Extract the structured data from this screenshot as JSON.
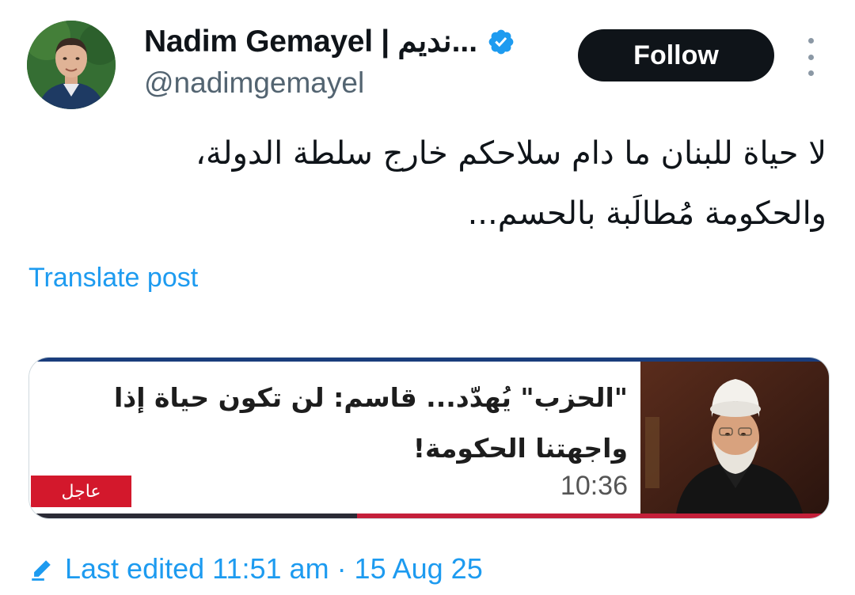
{
  "author": {
    "display_name": "Nadim Gemayel | نديم...",
    "handle": "@nadimgemayel",
    "verified_icon": "verified-badge-icon",
    "avatar_icon": "avatar"
  },
  "actions": {
    "follow_label": "Follow",
    "more_icon": "more-options-icon"
  },
  "post": {
    "text_line1": "لا حياة للبنان ما دام سلاحكم خارج سلطة الدولة،",
    "text_line2": "والحكومة مُطالَبة بالحسم...",
    "translate_label": "Translate post"
  },
  "media": {
    "headline_line1": "\"الحزب\" يُهدّد... قاسم: لن تكون حياة إذا",
    "headline_line2": "واجهتنا الحكومة!",
    "time": "10:36",
    "badge": "عاجل"
  },
  "footer": {
    "edited_label": "Last edited 11:51 am · 15 Aug 25",
    "edit_icon": "pencil-icon"
  },
  "colors": {
    "link": "#1d9bf0",
    "verified": "#1d9bf0",
    "follow_bg": "#0f1419",
    "badge_red": "#d3182c",
    "secondary_text": "#536471"
  }
}
